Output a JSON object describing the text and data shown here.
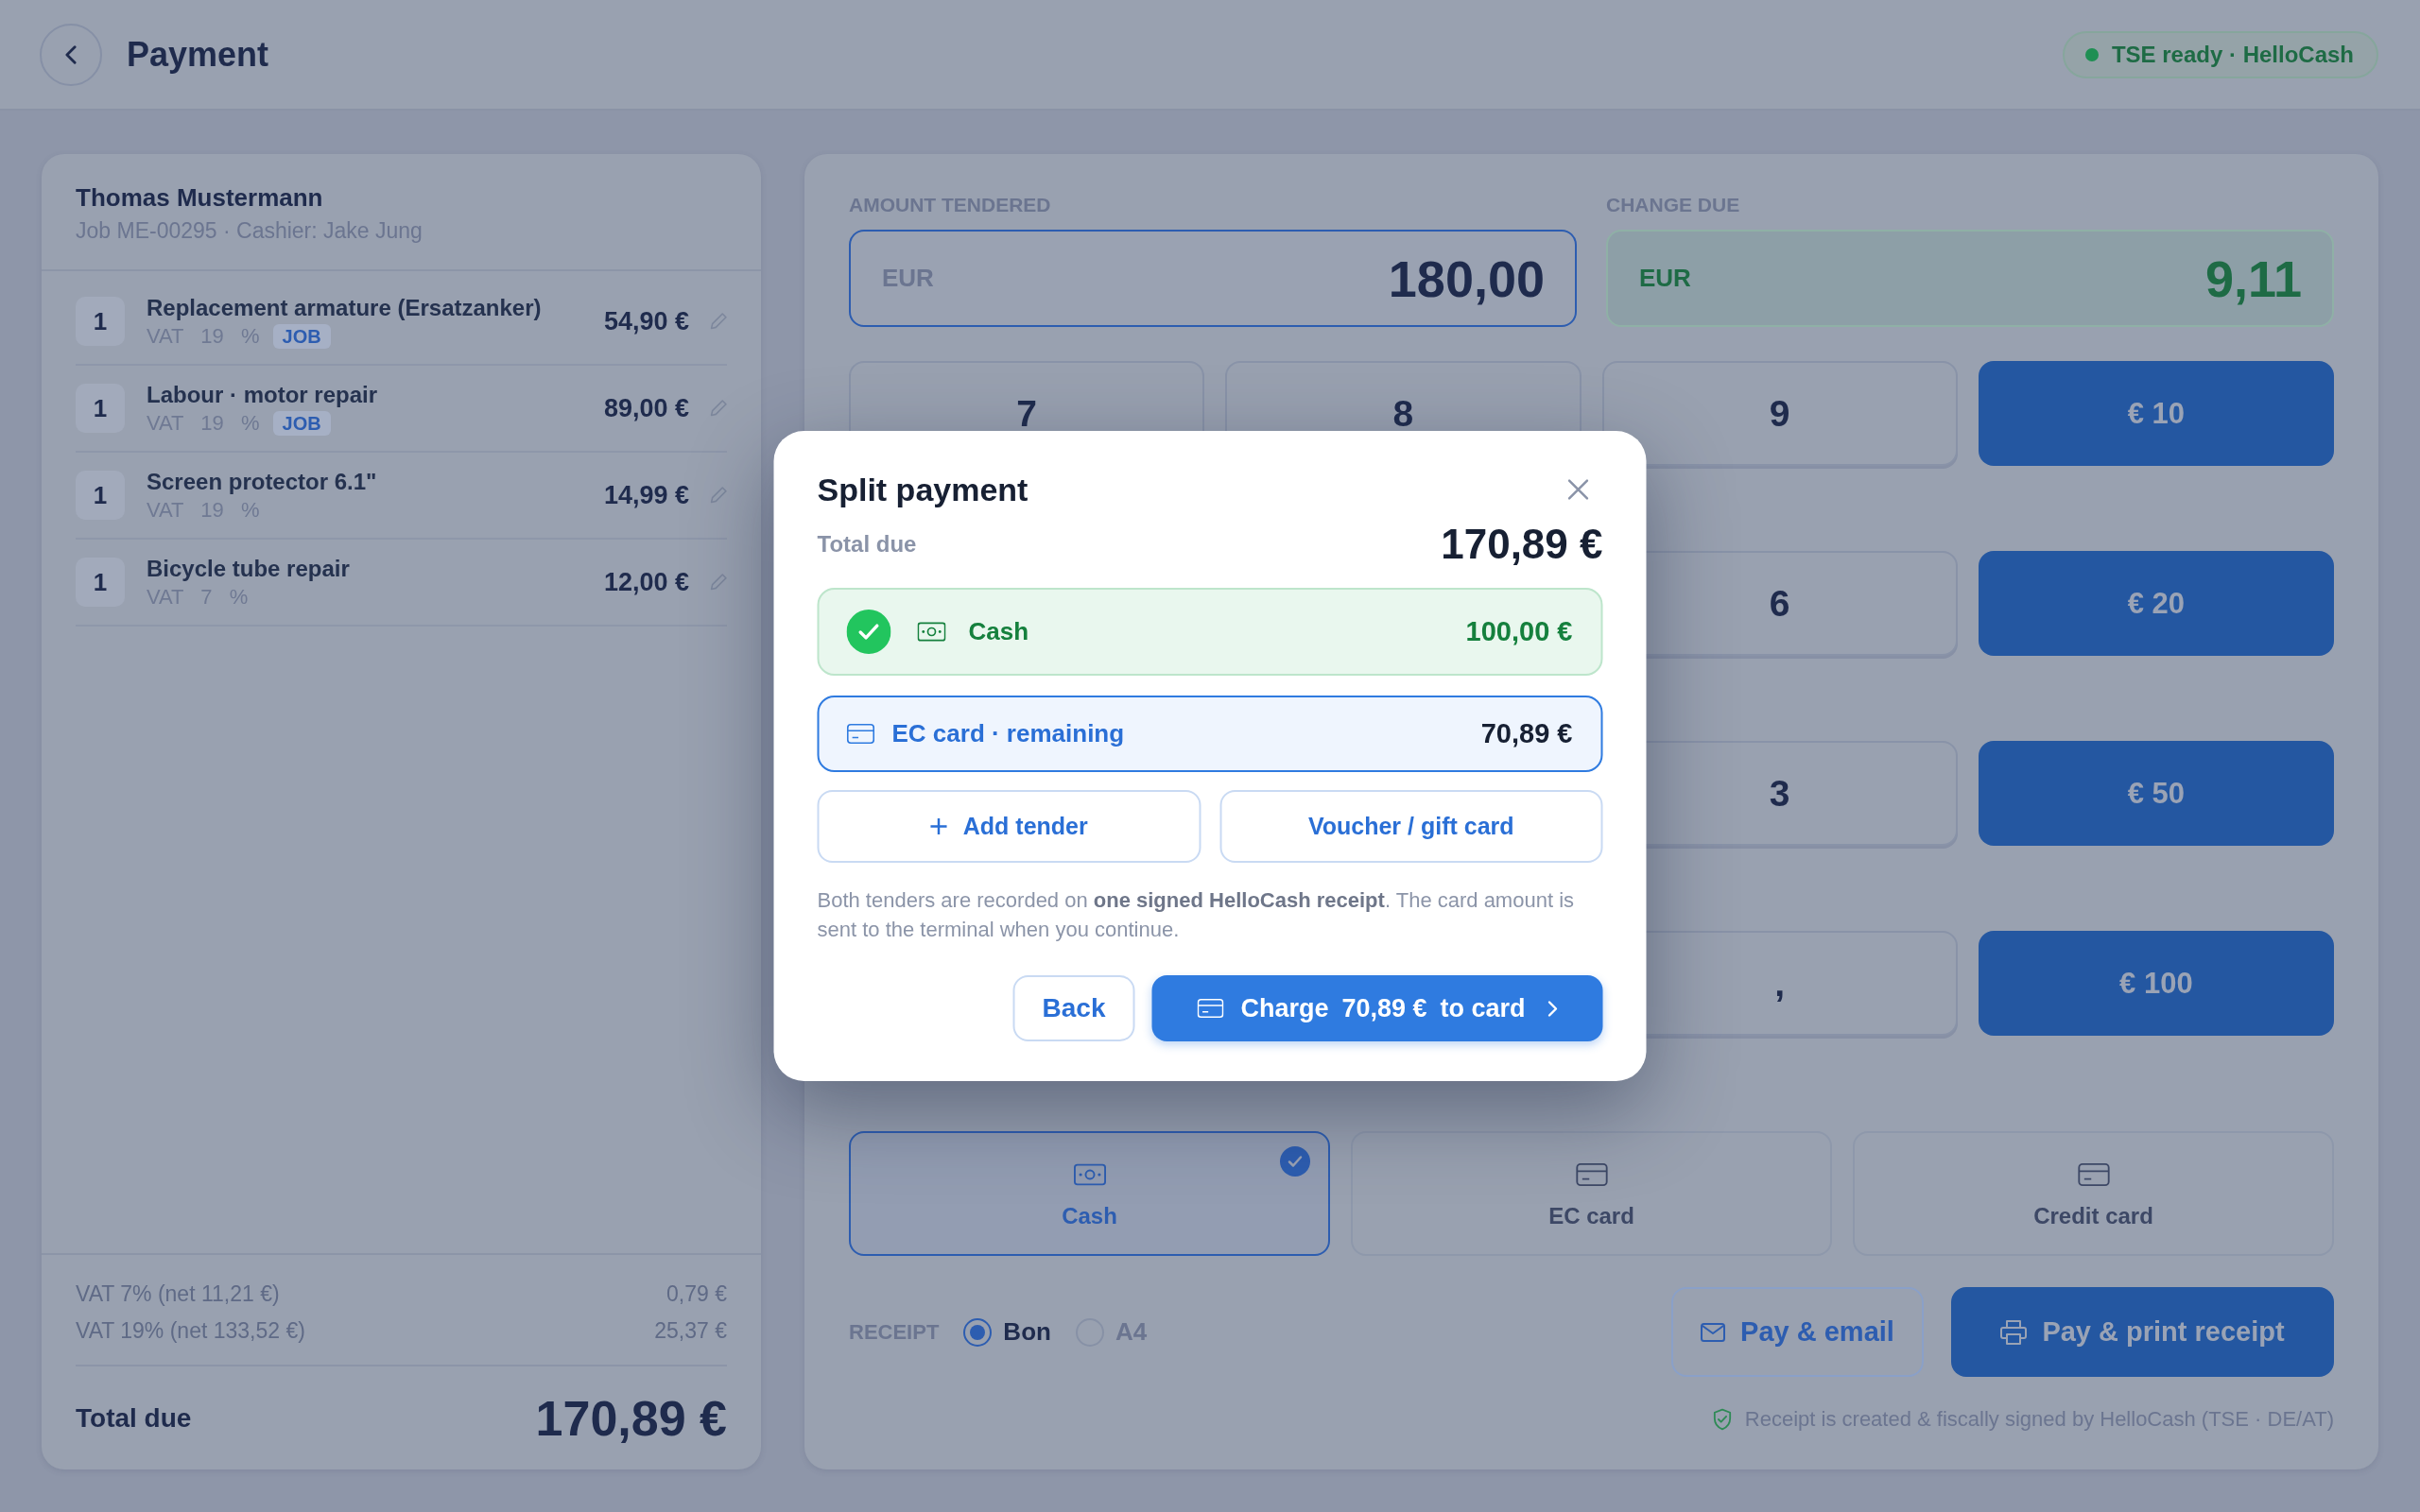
{
  "header": {
    "title": "Payment",
    "status": "TSE ready · HelloCash"
  },
  "order": {
    "customer": "Thomas Mustermann",
    "subtitle": "Job ME-00295 · Cashier: Jake Jung",
    "items": [
      {
        "qty": "1",
        "name": "Replacement armature (Ersatzanker)",
        "vat": "VAT 19 %",
        "tag": "JOB",
        "price": "54,90 €"
      },
      {
        "qty": "1",
        "name": "Labour · motor repair",
        "vat": "VAT 19 %",
        "tag": "JOB",
        "price": "89,00 €"
      },
      {
        "qty": "1",
        "name": "Screen protector 6.1\"",
        "vat": "VAT 19 %",
        "price": "14,99 €"
      },
      {
        "qty": "1",
        "name": "Bicycle tube repair",
        "vat": "VAT 7 %",
        "price": "12,00 €"
      }
    ],
    "vat_lines": [
      {
        "label": "VAT 7% (net 11,21 €)",
        "amount": "0,79 €"
      },
      {
        "label": "VAT 19% (net 133,52 €)",
        "amount": "25,37 €"
      }
    ],
    "total_label": "Total due",
    "total": "170,89 €"
  },
  "payment": {
    "amount_label": "AMOUNT TENDERED",
    "amount_currency": "EUR",
    "amount": "180,00",
    "change_label": "CHANGE DUE",
    "change_currency": "EUR",
    "change": "9,11",
    "keypad": [
      [
        {
          "label": "7",
          "kind": "digit"
        },
        {
          "label": "8",
          "kind": "digit"
        },
        {
          "label": "9",
          "kind": "digit"
        },
        {
          "label": "€ 10",
          "kind": "preset"
        }
      ],
      [
        {
          "label": "6",
          "kind": "digit"
        },
        {
          "label": "€ 20",
          "kind": "preset"
        }
      ],
      [
        {
          "label": "3",
          "kind": "digit"
        },
        {
          "label": "€ 50",
          "kind": "preset"
        }
      ],
      [
        {
          "label": ",",
          "kind": "digit"
        },
        {
          "label": "€ 100",
          "kind": "preset"
        }
      ]
    ],
    "methods": [
      {
        "label": "Cash",
        "kind": "cash",
        "selected": true
      },
      {
        "label": "EC card",
        "kind": "card",
        "selected": false
      },
      {
        "label": "Credit card",
        "kind": "card",
        "selected": false
      }
    ],
    "receipt_label": "RECEIPT",
    "receipt_options": [
      {
        "label": "Bon",
        "selected": true
      },
      {
        "label": "A4",
        "selected": false
      }
    ],
    "actions": [
      {
        "label": "Pay & email",
        "kind": "email"
      },
      {
        "label": "Pay & print receipt",
        "kind": "print"
      }
    ],
    "note": "Receipt is created & fiscally signed by HelloCash (TSE · DE/AT)"
  },
  "dialog": {
    "title": "Split payment",
    "total_label": "Total due",
    "total": "170,89 €",
    "tenders": [
      {
        "kind": "cash",
        "label": "Cash",
        "amount": "100,00 €",
        "paid": true,
        "selected": false
      },
      {
        "kind": "card",
        "label": "EC card · remaining",
        "amount": "70,89 €",
        "paid": false,
        "selected": true
      }
    ],
    "extras": [
      {
        "kind": "add",
        "label": "Add tender"
      },
      {
        "kind": "voucher",
        "label": "Voucher / gift card"
      }
    ],
    "note": "Both tenders are recorded on **one signed HelloCash receipt**. The card amount is sent to the terminal when you continue.",
    "back": "Back",
    "charge": {
      "prefix": "Charge",
      "amount": "70,89 €",
      "suffix": "to card"
    }
  }
}
